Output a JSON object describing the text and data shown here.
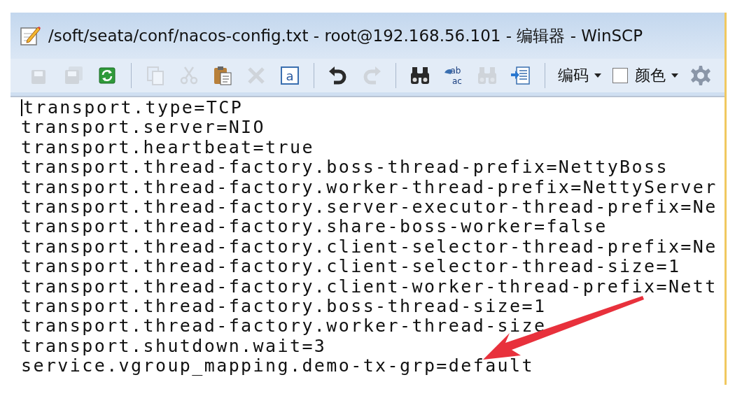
{
  "window": {
    "title": "/soft/seata/conf/nacos-config.txt - root@192.168.56.101 - 编辑器 - WinSCP"
  },
  "toolbar": {
    "groups": [
      [
        {
          "kind": "save",
          "disabled": true
        },
        {
          "kind": "save-all",
          "disabled": true
        },
        {
          "kind": "reload",
          "disabled": false
        }
      ],
      [
        {
          "kind": "copy",
          "disabled": true
        },
        {
          "kind": "cut",
          "disabled": true
        },
        {
          "kind": "paste",
          "disabled": false
        },
        {
          "kind": "delete",
          "disabled": true
        },
        {
          "kind": "select-all",
          "disabled": false,
          "glyph": "a"
        }
      ],
      [
        {
          "kind": "undo",
          "disabled": false
        },
        {
          "kind": "redo",
          "disabled": true
        }
      ],
      [
        {
          "kind": "find",
          "disabled": false
        },
        {
          "kind": "replace",
          "disabled": false,
          "glyph": "ab",
          "glyph2": "ac"
        },
        {
          "kind": "find-next",
          "disabled": true
        },
        {
          "kind": "goto-line",
          "disabled": false
        }
      ]
    ],
    "encoding": {
      "label": "编码"
    },
    "color": {
      "label": "颜色",
      "checked": false
    }
  },
  "editor": {
    "lines": [
      "transport.type=TCP",
      "transport.server=NIO",
      "transport.heartbeat=true",
      "transport.thread-factory.boss-thread-prefix=NettyBoss",
      "transport.thread-factory.worker-thread-prefix=NettyServer",
      "transport.thread-factory.server-executor-thread-prefix=Ne",
      "transport.thread-factory.share-boss-worker=false",
      "transport.thread-factory.client-selector-thread-prefix=Ne",
      "transport.thread-factory.client-selector-thread-size=1",
      "transport.thread-factory.client-worker-thread-prefix=Nett",
      "transport.thread-factory.boss-thread-size=1",
      "transport.thread-factory.worker-thread-size",
      "transport.shutdown.wait=3",
      "service.vgroup_mapping.demo-tx-grp=default"
    ]
  }
}
